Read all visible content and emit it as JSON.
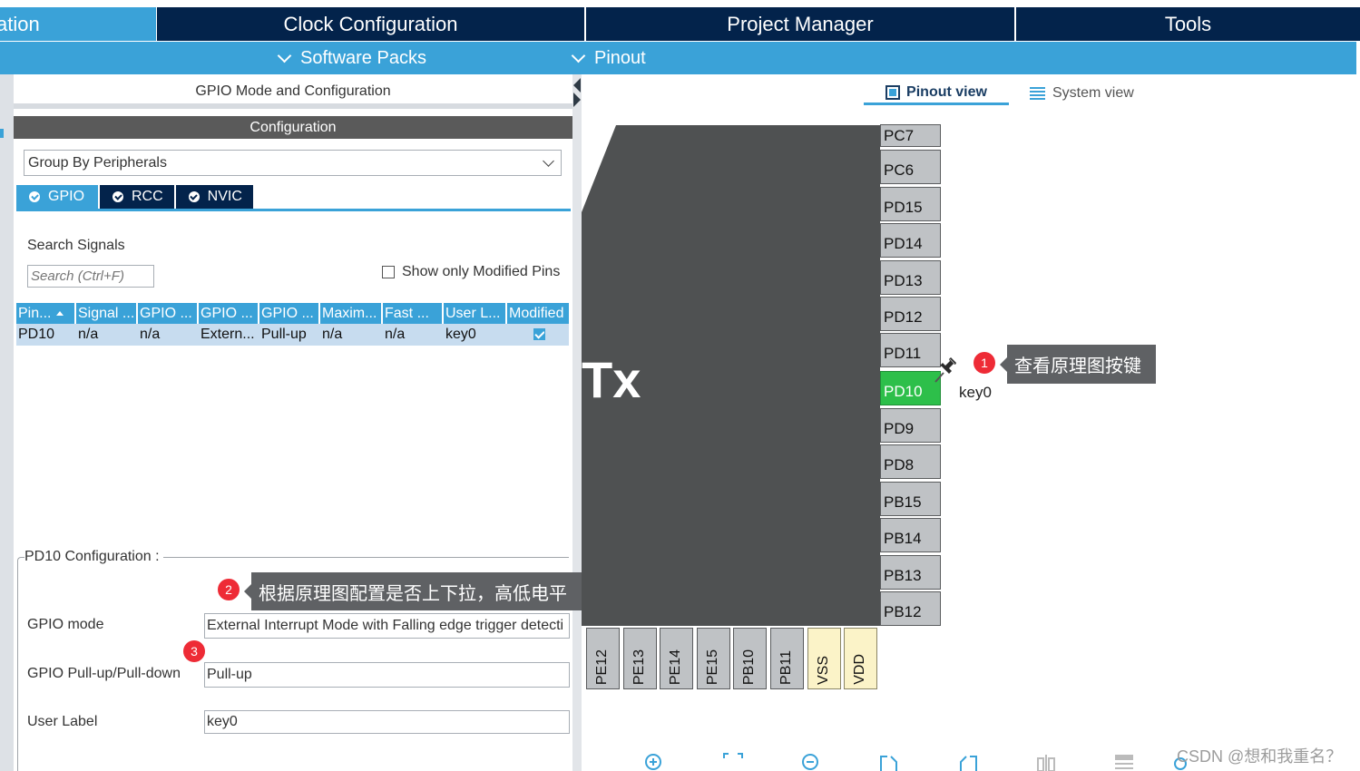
{
  "top_tabs": {
    "pinout_partial": "ation",
    "clock": "Clock Configuration",
    "project": "Project Manager",
    "tools": "Tools"
  },
  "sub_menu": {
    "software_packs": "Software Packs",
    "pinout": "Pinout"
  },
  "left_panel": {
    "title": "GPIO Mode and Configuration",
    "config_header": "Configuration",
    "group_select": "Group By Peripherals",
    "tabs": [
      {
        "label": "GPIO",
        "active": true
      },
      {
        "label": "RCC",
        "active": false
      },
      {
        "label": "NVIC",
        "active": false
      }
    ],
    "search_label": "Search Signals",
    "search_placeholder": "Search (Ctrl+F)",
    "show_modified": "Show only Modified Pins",
    "table": {
      "headers": [
        "Pin...",
        "Signal ...",
        "GPIO ...",
        "GPIO ...",
        "GPIO ...",
        "Maxim...",
        "Fast ...",
        "User L...",
        "Modified"
      ],
      "rows": [
        [
          "PD10",
          "n/a",
          "n/a",
          "Extern...",
          "Pull-up",
          "n/a",
          "n/a",
          "key0",
          true
        ]
      ]
    },
    "pd10_config": {
      "legend": "PD10 Configuration :",
      "gpio_mode_label": "GPIO mode",
      "gpio_mode_value": "External Interrupt Mode with Falling edge trigger detecti",
      "pull_label": "GPIO Pull-up/Pull-down",
      "pull_value": "Pull-up",
      "user_label_label": "User Label",
      "user_label_value": "key0"
    }
  },
  "right_panel": {
    "pinout_view": "Pinout view",
    "system_view": "System view",
    "chip_label": "Tx",
    "right_pins": [
      "PC7",
      "PC6",
      "PD15",
      "PD14",
      "PD13",
      "PD12",
      "PD11",
      "PD10",
      "PD9",
      "PD8",
      "PB15",
      "PB14",
      "PB13",
      "PB12"
    ],
    "highlighted_pin": "PD10",
    "bottom_pins": [
      "PE12",
      "PE13",
      "PE14",
      "PE15",
      "PB10",
      "PB11",
      "VSS",
      "VDD"
    ],
    "pin_user_label": "key0"
  },
  "annotations": [
    {
      "number": "1",
      "text": "查看原理图按键"
    },
    {
      "number": "2",
      "text": "根据原理图配置是否上下拉，高低电平"
    },
    {
      "number": "3",
      "text": ""
    }
  ],
  "watermark": "CSDN @想和我重名？",
  "colors": {
    "accent_blue": "#3aa2d8",
    "navy": "#03234b",
    "pin_green": "#2dbf4a",
    "badge_red": "#ee2b36"
  }
}
